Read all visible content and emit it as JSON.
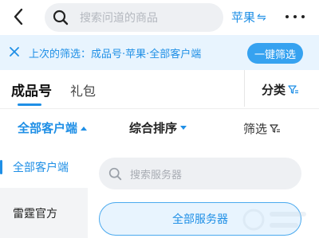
{
  "header": {
    "search_placeholder": "搜索问道的商品",
    "game_label": "苹果",
    "game_switch_glyph": "⇋"
  },
  "last_filter": {
    "text": "上次的筛选：成品号·苹果·全部客户端",
    "button": "一键筛选"
  },
  "tabs": {
    "finished": "成品号",
    "gift": "礼包",
    "category": "分类"
  },
  "sort": {
    "client": "全部客户端",
    "order": "综合排序",
    "filter": "筛选"
  },
  "clients": [
    {
      "label": "全部客户端",
      "active": true
    },
    {
      "label": "雷霆官方",
      "active": false
    }
  ],
  "servers": {
    "search_placeholder": "搜索服务器",
    "all_button": "全部服务器"
  },
  "colors": {
    "accent": "#1f8fe6",
    "accent_light": "#e8f4fe",
    "button": "#36a2f0"
  }
}
